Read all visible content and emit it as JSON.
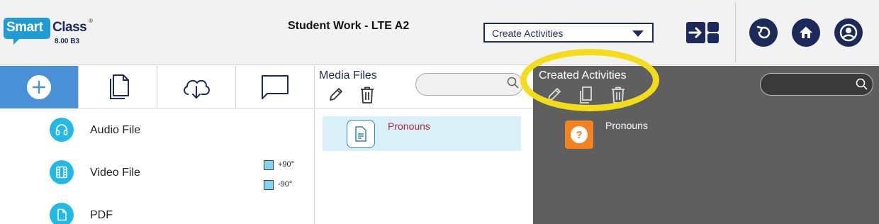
{
  "app": {
    "logo_smart": "Smart",
    "logo_class": "Class",
    "logo_reg": "®",
    "version": "8.00 B3"
  },
  "header": {
    "title": "Student Work - LTE A2",
    "activity_select": {
      "value": "Create Activities"
    }
  },
  "toolbar": {
    "items": [
      {
        "icon": "plus-icon",
        "active": true
      },
      {
        "icon": "documents-icon"
      },
      {
        "icon": "cloud-download-icon"
      },
      {
        "icon": "chat-icon"
      }
    ]
  },
  "media_panel": {
    "title": "Media Files",
    "items": [
      {
        "label": "Pronouns",
        "icon": "document-icon"
      }
    ]
  },
  "created_panel": {
    "title": "Created Activities",
    "highlight_color": "#f3dc1a",
    "items": [
      {
        "label": "Pronouns",
        "icon_text": "?",
        "icon_color": "#f58220"
      }
    ]
  },
  "file_types": [
    {
      "label": "Audio File",
      "icon": "headphones-icon"
    },
    {
      "label": "Video File",
      "icon": "film-icon"
    },
    {
      "label": "PDF",
      "icon": "file-icon"
    }
  ],
  "rotation": [
    {
      "label": "+90°"
    },
    {
      "label": "-90°"
    }
  ],
  "colors": {
    "navy": "#1b2a5a",
    "accent_blue": "#4a90d6",
    "cyan": "#22b9e6",
    "panel_dark": "#5f5f5f"
  }
}
